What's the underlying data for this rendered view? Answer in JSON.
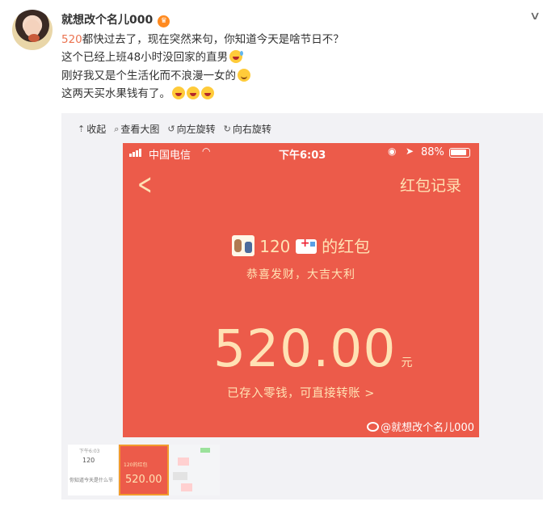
{
  "post": {
    "username": "就想改个名儿000",
    "badge_icon": "crown-badge-icon",
    "more_icon": "chevron-down-icon",
    "lines": [
      {
        "highlight": "520",
        "text": "都快过去了，现在突然来句，你知道今天是啥节日不？"
      },
      {
        "text": "这个已经上班48小时没回家的直男"
      },
      {
        "text": "刚好我又是个生活化而不浪漫一女的"
      },
      {
        "text": "这两天买水果钱有了。"
      }
    ],
    "highlight_color": "#eb7350"
  },
  "toolbar": {
    "collapse": "收起",
    "view_large": "查看大图",
    "rotate_left": "向左旋转",
    "rotate_right": "向右旋转"
  },
  "photo": {
    "status_bar": {
      "carrier": "中国电信",
      "time": "下午6:03",
      "battery": "88%"
    },
    "header_right": "红包记录",
    "sender": "120",
    "sender_suffix": "的红包",
    "blessing": "恭喜发财，大吉大利",
    "amount": "520.00",
    "unit": "元",
    "deposit_note": "已存入零钱，可直接转账 >",
    "watermark": "@就想改个名儿000",
    "bg_color": "#ec5b4a",
    "text_color": "#ffe2b4"
  },
  "thumbnails": {
    "t1_time": "下午6:03",
    "t1_sender": "120",
    "t1_caption": "你知道今天是什么节",
    "t2_title": "120的红包",
    "t2_amount": "520.00"
  }
}
